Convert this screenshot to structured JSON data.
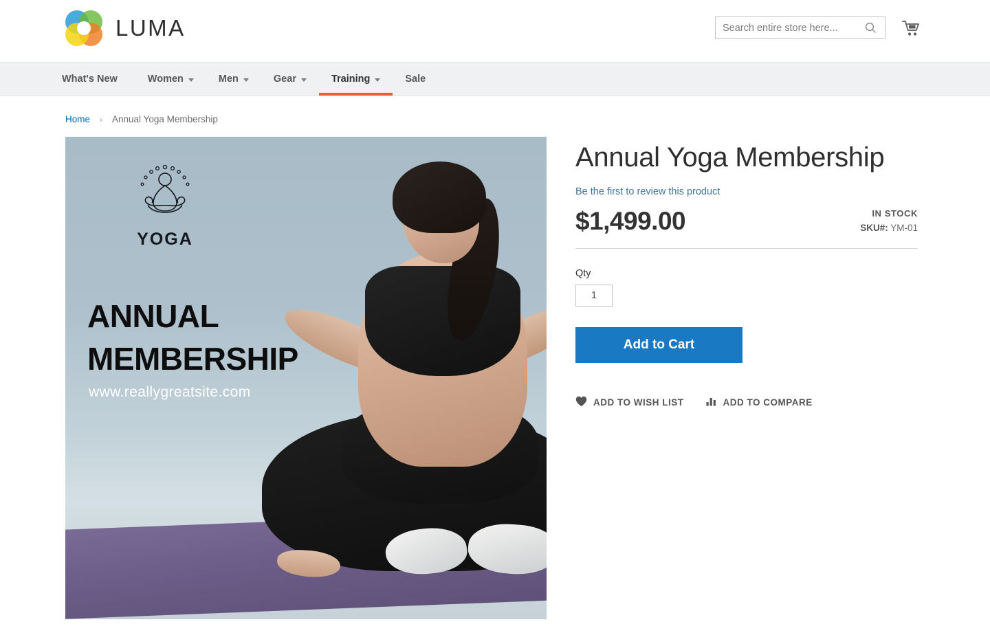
{
  "header": {
    "logo_text": "LUMA",
    "logo_icon": "luma-rings-logo",
    "search": {
      "placeholder": "Search entire store here...",
      "value": "",
      "icon": "search-icon"
    },
    "cart_icon": "shopping-cart-icon"
  },
  "nav": {
    "items": [
      {
        "label": "What's New",
        "has_caret": false,
        "active": false
      },
      {
        "label": "Women",
        "has_caret": true,
        "active": false
      },
      {
        "label": "Men",
        "has_caret": true,
        "active": false
      },
      {
        "label": "Gear",
        "has_caret": true,
        "active": false
      },
      {
        "label": "Training",
        "has_caret": true,
        "active": true
      },
      {
        "label": "Sale",
        "has_caret": false,
        "active": false
      }
    ],
    "active_accent": "#e06425"
  },
  "breadcrumb": {
    "home": "Home",
    "separator": "›",
    "current": "Annual Yoga Membership"
  },
  "product_image": {
    "badge_word": "YOGA",
    "badge_icon": "yoga-lotus-figure-icon",
    "title_line1": "ANNUAL",
    "title_line2": "MEMBERSHIP",
    "url": "www.reallygreatsite.com",
    "background_color": "#a9bcc8",
    "mat_color": "#6c5c88",
    "alt": "Woman seated in lotus pose on a purple yoga mat"
  },
  "product": {
    "title": "Annual Yoga Membership",
    "review_link": "Be the first to review this product",
    "price": "$1,499.00",
    "stock_status": "IN STOCK",
    "sku_label": "SKU#:",
    "sku_value": "YM-01",
    "qty_label": "Qty",
    "qty_value": "1",
    "add_to_cart_label": "Add to Cart",
    "add_to_cart_color": "#1979c3",
    "wish_list_label": "ADD TO WISH LIST",
    "wish_list_icon": "heart-icon",
    "compare_label": "ADD TO COMPARE",
    "compare_icon": "bar-chart-icon"
  }
}
